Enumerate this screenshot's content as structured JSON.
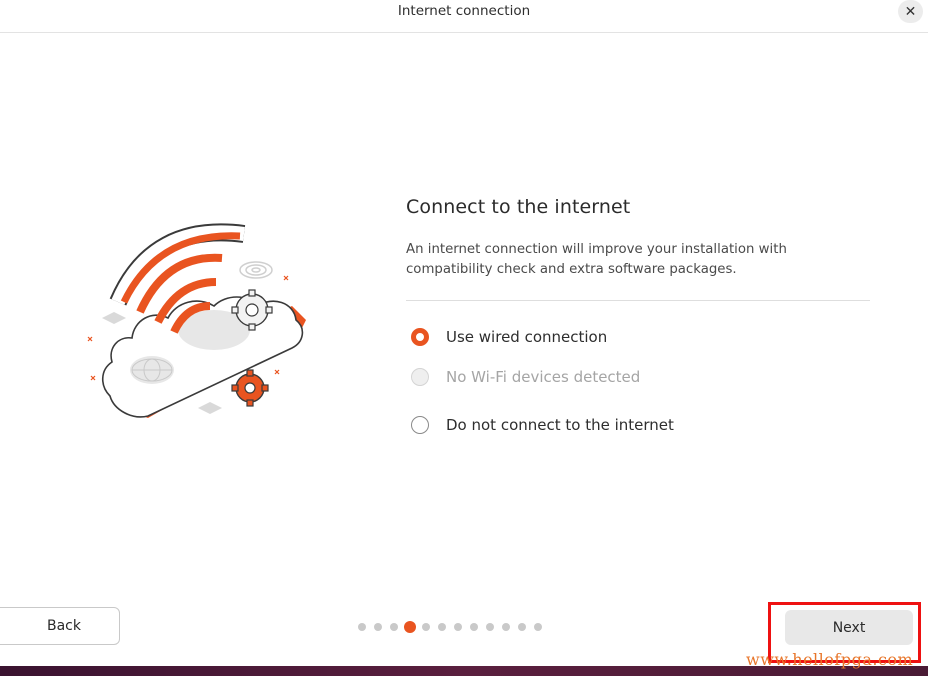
{
  "window": {
    "title": "Internet connection",
    "close_icon": "close-icon"
  },
  "main": {
    "heading": "Connect to the internet",
    "description": "An internet connection will improve your installation with compatibility check and extra software packages.",
    "options": [
      {
        "label": "Use wired connection",
        "state": "selected"
      },
      {
        "label": "No Wi-Fi devices detected",
        "state": "disabled"
      },
      {
        "label": "Do not connect to the internet",
        "state": "unselected"
      }
    ]
  },
  "footer": {
    "back_label": "Back",
    "next_label": "Next",
    "pagination": {
      "total": 12,
      "current": 4
    }
  },
  "watermark": "www.hellofpga.com",
  "colors": {
    "accent": "#e95420",
    "highlight": "#ee1111"
  }
}
